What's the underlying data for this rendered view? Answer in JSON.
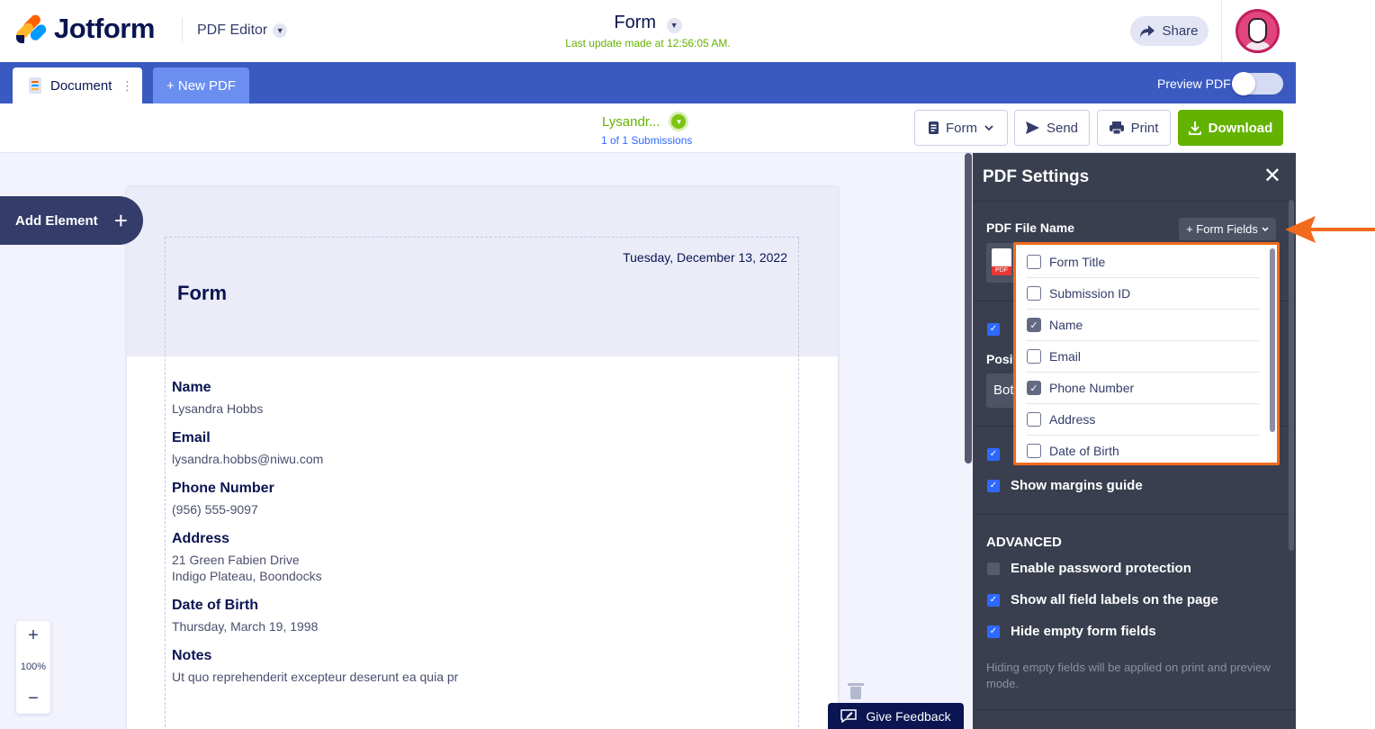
{
  "header": {
    "brand": "Jotform",
    "app_name": "PDF Editor",
    "form_title": "Form",
    "last_update": "Last update made at 12:56:05 AM.",
    "share_label": "Share"
  },
  "tabs": {
    "document_label": "Document",
    "new_pdf_label": "+ New PDF",
    "preview_label": "Preview PDF",
    "preview_on": false
  },
  "toolbar": {
    "submitter": "Lysandr...",
    "submission_count": "1 of 1 Submissions",
    "form_label": "Form",
    "send_label": "Send",
    "print_label": "Print",
    "download_label": "Download"
  },
  "canvas": {
    "add_element_label": "Add Element",
    "zoom_level": "100%",
    "feedback_label": "Give Feedback"
  },
  "page": {
    "date": "Tuesday, December 13, 2022",
    "title": "Form",
    "fields": [
      {
        "label": "Name",
        "value": "Lysandra Hobbs",
        "value2": ""
      },
      {
        "label": "Email",
        "value": "lysandra.hobbs@niwu.com",
        "value2": ""
      },
      {
        "label": "Phone Number",
        "value": "(956) 555-9097",
        "value2": ""
      },
      {
        "label": "Address",
        "value": "21 Green Fabien Drive",
        "value2": "Indigo Plateau, Boondocks"
      },
      {
        "label": "Date of Birth",
        "value": "Thursday, March 19, 1998",
        "value2": ""
      },
      {
        "label": "Notes",
        "value": "Ut quo reprehenderit excepteur deserunt ea quia pr",
        "value2": ""
      }
    ]
  },
  "panel": {
    "title": "PDF Settings",
    "file_name_label": "PDF File Name",
    "form_fields_label": "+ Form Fields",
    "pdf_icon_text": "PDF",
    "position_label": "Positi",
    "position_value": "Bot",
    "show_margins_label": "Show margins guide",
    "advanced_label": "ADVANCED",
    "password_label": "Enable password protection",
    "show_labels_label": "Show all field labels on the page",
    "hide_empty_label": "Hide empty form fields",
    "hint": "Hiding empty fields will be applied on print and preview mode."
  },
  "dropdown": {
    "items": [
      {
        "label": "Form Title",
        "checked": false
      },
      {
        "label": "Submission ID",
        "checked": false
      },
      {
        "label": "Name",
        "checked": true
      },
      {
        "label": "Email",
        "checked": false
      },
      {
        "label": "Phone Number",
        "checked": true
      },
      {
        "label": "Address",
        "checked": false
      },
      {
        "label": "Date of Birth",
        "checked": false
      }
    ]
  },
  "colors": {
    "brand_blue": "#3a5ac2",
    "download_green": "#64b200",
    "annotation_orange": "#f26a1b",
    "panel_dark": "#3a3f4f"
  }
}
